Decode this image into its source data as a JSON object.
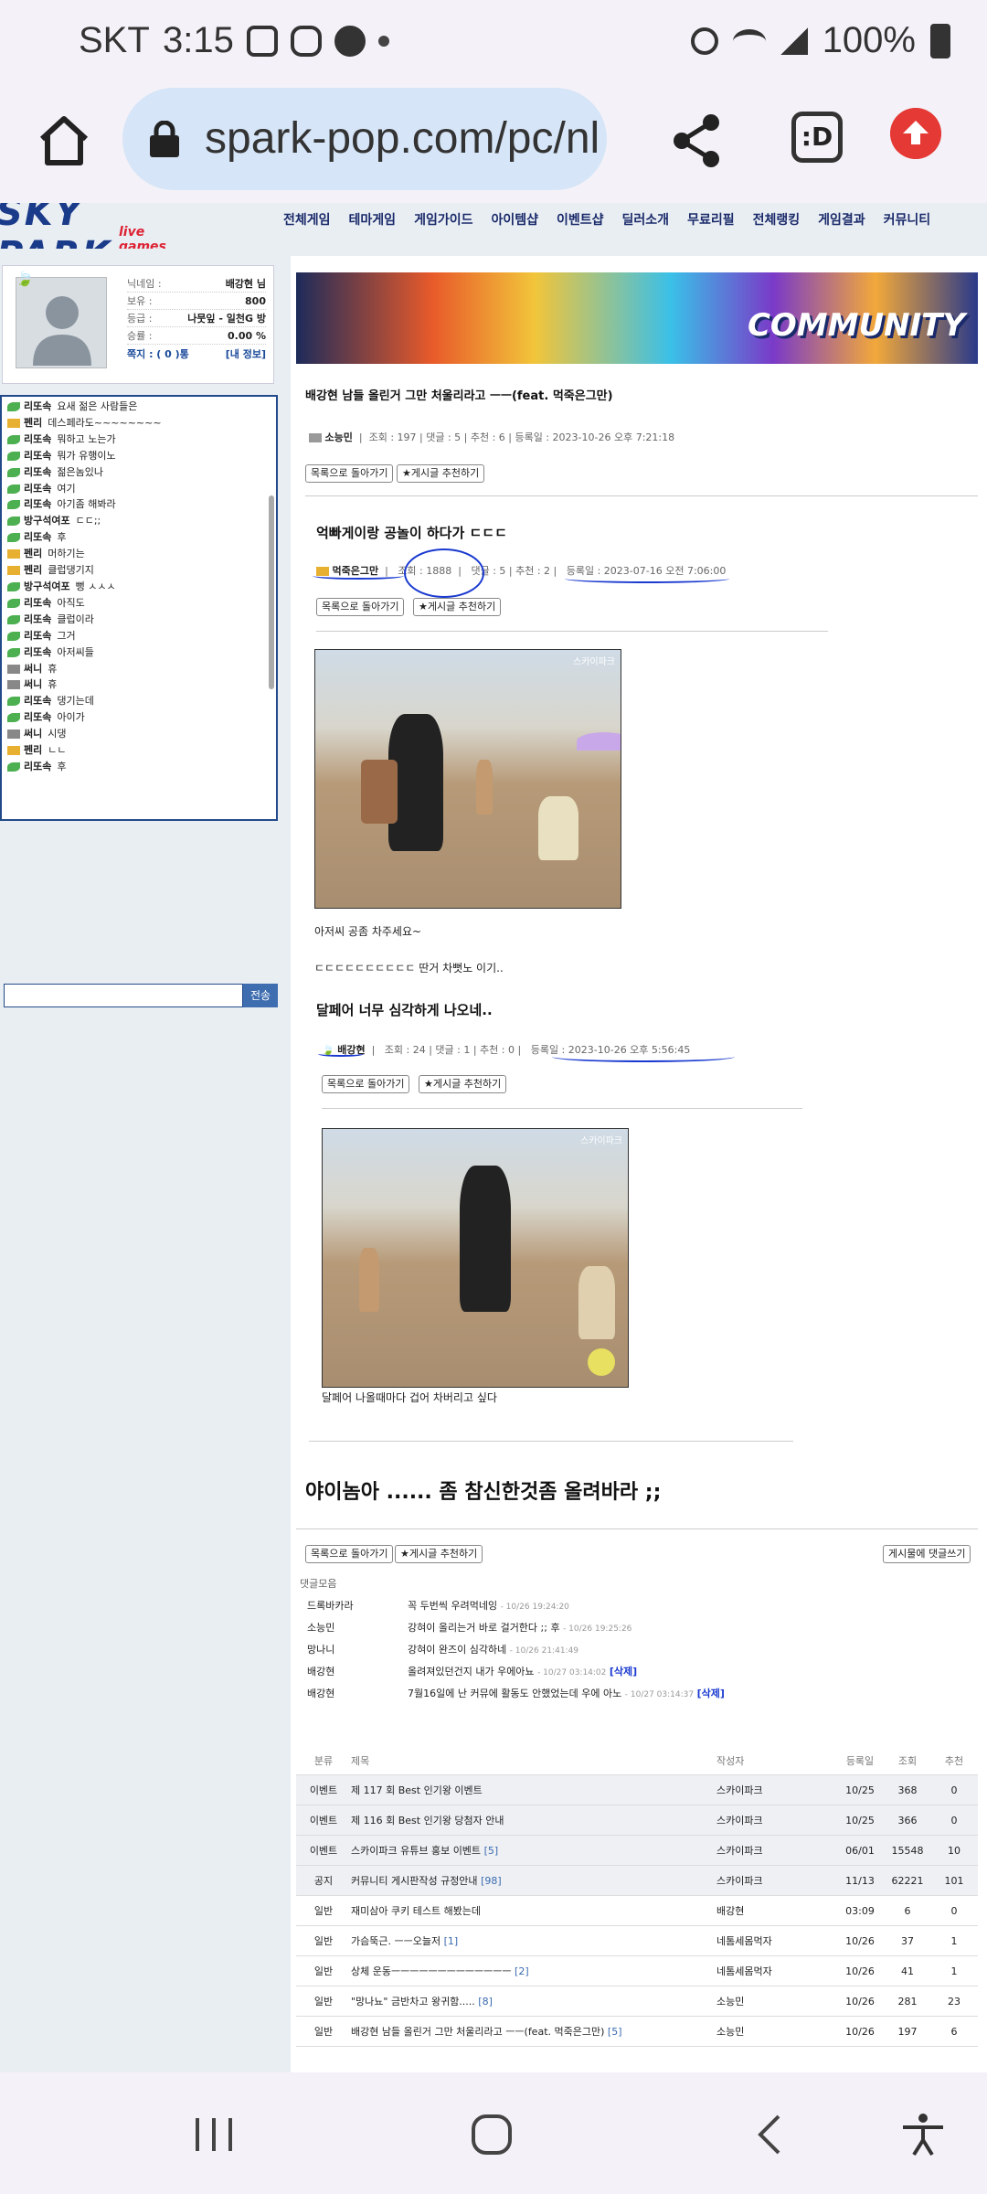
{
  "status": {
    "carrier": "SKT",
    "time": "3:15",
    "battery": "100%"
  },
  "browser": {
    "url": "spark-pop.com/pc/nl",
    "tabs_label": ":D"
  },
  "site": {
    "logo": "SKY PARK",
    "logo_sub": "live games",
    "nav": [
      "전체게임",
      "테마게임",
      "게임가이드",
      "아이템샵",
      "이벤트샵",
      "딜러소개",
      "무료리필",
      "전체랭킹",
      "게임결과",
      "커뮤니티"
    ],
    "banner_text": "COMMUNITY"
  },
  "profile": {
    "rows": [
      {
        "k": "닉네임 :",
        "v": "배강현 님"
      },
      {
        "k": "보유 :",
        "v": "800"
      },
      {
        "k": "등급 :",
        "v": "나뭇잎 - 일천G 방"
      },
      {
        "k": "승률 :",
        "v": "0.00 %"
      }
    ],
    "gift": "쪽지 : ( 0 )통",
    "info": "[내 정보]"
  },
  "chat": {
    "send": "전송",
    "messages": [
      {
        "n": "리또속",
        "t": "요새 젊은 사람들은"
      },
      {
        "n": "펜리",
        "t": "데스페라도~~~~~~~~"
      },
      {
        "n": "리또속",
        "t": "뭐하고 노는가"
      },
      {
        "n": "리또속",
        "t": "뭐가 유행이노"
      },
      {
        "n": "리또속",
        "t": "젊은놈있나"
      },
      {
        "n": "리또속",
        "t": "여기"
      },
      {
        "n": "리또속",
        "t": "아기좀 해봐라"
      },
      {
        "n": "방구석여포",
        "t": "ㄷㄷ;;"
      },
      {
        "n": "리또속",
        "t": "후"
      },
      {
        "n": "펜리",
        "t": "머하기는"
      },
      {
        "n": "펜리",
        "t": "클럽댕기지"
      },
      {
        "n": "방구석여포",
        "t": "뻥 ㅅㅅㅅ"
      },
      {
        "n": "리또속",
        "t": "아직도"
      },
      {
        "n": "리또속",
        "t": "클럽이라"
      },
      {
        "n": "리또속",
        "t": "그거"
      },
      {
        "n": "리또속",
        "t": "아저씨들"
      },
      {
        "n": "써니",
        "t": "휴"
      },
      {
        "n": "써니",
        "t": "휴"
      },
      {
        "n": "리또속",
        "t": "댕기는데"
      },
      {
        "n": "리또속",
        "t": "아이가"
      },
      {
        "n": "써니",
        "t": "시댕"
      },
      {
        "n": "펜리",
        "t": "ㄴㄴ"
      },
      {
        "n": "리또속",
        "t": "후"
      }
    ]
  },
  "post": {
    "title": "배강현 남들 올린거 그만 처울리라고 ㅡㅡ(feat. 먹죽은그만)",
    "author": "소능민",
    "meta": "조회 : 197  |  댓글 : 5  |  추천 : 6  |  등록일 : 2023-10-26 오후 7:21:18",
    "back": "목록으로 돌아가기",
    "recommend": "★게시글 추천하기",
    "reply": "게시물에 댓글쓰기"
  },
  "quote1": {
    "title": "억빠게이랑 공놀이 하다가 ㄷㄷㄷ",
    "author": "먹죽은그만",
    "views": "조회 : 1888",
    "rest": "댓글 : 5  |  추천 : 2  |",
    "date": "등록일 : 2023-07-16 오전 7:06:00",
    "wm": "스카이파크",
    "text1": "아저씨 공좀 차주세요~",
    "text2": "ㄷㄷㄷㄷㄷㄷㄷㄷㄷㄷ 딴거 차뻣노 이기.."
  },
  "quote2": {
    "title": "달페어 너무 심각하게 나오네..",
    "author": "배강현",
    "meta": "조회 : 24  |  댓글 : 1  |  추천 : 0  |",
    "date": "등록일 : 2023-10-26 오후 5:56:45",
    "text": "달페어 나올때마다 겁어 차버리고 싶다"
  },
  "post_body": "야이놈아 ...... 좀 참신한것좀 올려바라 ;;",
  "replies": {
    "header": "댓글모음",
    "items": [
      {
        "n": "드록바카라",
        "t": "꼭 두번씩 우려먹네잉",
        "time": "- 10/26 19:24:20",
        "del": ""
      },
      {
        "n": "소능민",
        "t": "강혀이 올리는거 바로 걸거한다 ;; 후",
        "time": "- 10/26 19:25:26",
        "del": ""
      },
      {
        "n": "망나니",
        "t": "강혀이 완즈이 심각하네",
        "time": "- 10/26 21:41:49",
        "del": ""
      },
      {
        "n": "배강현",
        "t": "올려져있던건지 내가 우에아뇨",
        "time": "- 10/27 03:14:02",
        "del": "[삭제]"
      },
      {
        "n": "배강현",
        "t": "7월16일에 난 커뮤에 활동도 안했었는데 우에 아노",
        "time": "- 10/27 03:14:37",
        "del": "[삭제]"
      }
    ]
  },
  "table": {
    "headers": [
      "분류",
      "제목",
      "작성자",
      "등록일",
      "조회",
      "추천"
    ],
    "rows": [
      {
        "c": "이벤트",
        "t": "제 117 회 Best 인기왕 이벤트",
        "cnt": "",
        "a": "스카이파크",
        "d": "10/25",
        "v": "368",
        "r": "0",
        "notice": true
      },
      {
        "c": "이벤트",
        "t": "제 116 회 Best 인기왕 당첨자 안내",
        "cnt": "",
        "a": "스카이파크",
        "d": "10/25",
        "v": "366",
        "r": "0",
        "notice": true
      },
      {
        "c": "이벤트",
        "t": "스카이파크 유튜브 홍보 이벤트",
        "cnt": "[5]",
        "a": "스카이파크",
        "d": "06/01",
        "v": "15548",
        "r": "10",
        "notice": true
      },
      {
        "c": "공지",
        "t": "커뮤니티 게시판작성 규정안내",
        "cnt": "[98]",
        "a": "스카이파크",
        "d": "11/13",
        "v": "62221",
        "r": "101",
        "notice": true
      },
      {
        "c": "일반",
        "t": "재미삼아 쿠키 테스트 해봤는데",
        "cnt": "",
        "a": "배강현",
        "d": "03:09",
        "v": "6",
        "r": "0",
        "notice": false
      },
      {
        "c": "일반",
        "t": "가슴뚝근. ㅡㅡ오늘저",
        "cnt": "[1]",
        "a": "네톰세몸먹자",
        "d": "10/26",
        "v": "37",
        "r": "1",
        "notice": false
      },
      {
        "c": "일반",
        "t": "상체 운동ㅡㅡㅡㅡㅡㅡㅡㅡㅡㅡㅡㅡㅡ",
        "cnt": "[2]",
        "a": "네톰세몸먹자",
        "d": "10/26",
        "v": "41",
        "r": "1",
        "notice": false
      },
      {
        "c": "일반",
        "t": "\"망나뇨\" 금반차고 왕귀함.....",
        "cnt": "[8]",
        "a": "소능민",
        "d": "10/26",
        "v": "281",
        "r": "23",
        "notice": false
      },
      {
        "c": "일반",
        "t": "배강현 남들 올린거 그만 처울리라고 ㅡㅡ(feat. 먹죽은그만)",
        "cnt": "[5]",
        "a": "소능민",
        "d": "10/26",
        "v": "197",
        "r": "6",
        "notice": false
      }
    ]
  },
  "colors": {
    "link_blue": "#1a3ad0",
    "chat_border": "#224a8a",
    "send_btn": "#3e6db0"
  }
}
